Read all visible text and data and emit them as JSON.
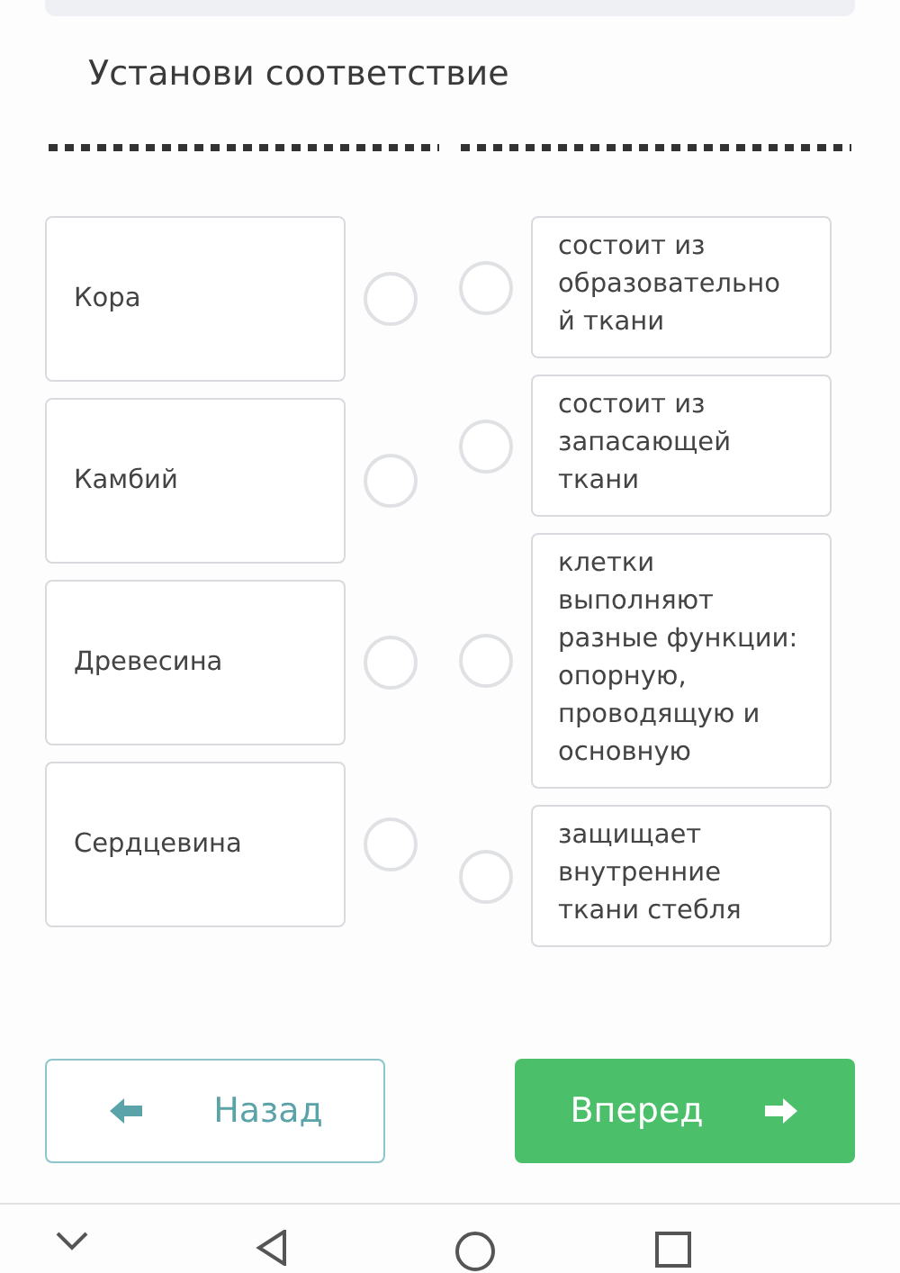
{
  "title": "Установи соответствие",
  "left_items": [
    {
      "label": "Кора",
      "selected": false
    },
    {
      "label": "Камбий",
      "selected": false
    },
    {
      "label": "Древесина",
      "selected": false
    },
    {
      "label": "Сердцевина",
      "selected": false
    }
  ],
  "right_items": [
    {
      "label": "состоит из образовательно й ткани",
      "selected": false
    },
    {
      "label": "состоит из запасающей ткани",
      "selected": false
    },
    {
      "label": "клетки выполняют разные функции: опорную, проводящую и основную",
      "selected": false
    },
    {
      "label": "защищает внутренние ткани стебля",
      "selected": false
    }
  ],
  "buttons": [
    {
      "kind": "back",
      "label": "Назад"
    },
    {
      "kind": "next",
      "label": "Вперед"
    }
  ]
}
